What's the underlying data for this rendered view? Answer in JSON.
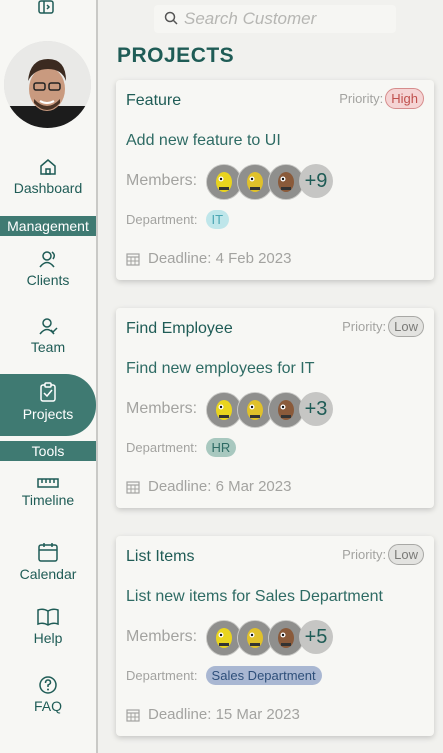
{
  "search": {
    "placeholder": "Search Customer"
  },
  "page": {
    "title": "PROJECTS"
  },
  "nav": {
    "dashboard": "Dashboard",
    "management": "Management",
    "clients": "Clients",
    "team": "Team",
    "projects": "Projects",
    "tools": "Tools",
    "timeline": "Timeline",
    "calendar": "Calendar",
    "help": "Help",
    "faq": "FAQ"
  },
  "labels": {
    "priority": "Priority:",
    "members": "Members:",
    "department": "Department:",
    "deadline": "Deadline:"
  },
  "projects": [
    {
      "title": "Feature",
      "priority": "High",
      "description": "Add new feature to UI",
      "members_more": "+9",
      "department": "IT",
      "department_color": "#bfe6ea",
      "department_text_color": "#4ba6b3",
      "deadline": "4 Feb 2023"
    },
    {
      "title": "Find Employee",
      "priority": "Low",
      "description": "Find new employees for IT",
      "members_more": "+3",
      "department": "HR",
      "department_color": "#a8c8bf",
      "department_text_color": "#2e6b64",
      "deadline": "6 Mar 2023"
    },
    {
      "title": "List Items",
      "priority": "Low",
      "description": "List new items for Sales Department",
      "members_more": "+5",
      "department": "Sales Department",
      "department_color": "#a9b7d2",
      "department_text_color": "#2e4f7a",
      "deadline": "15 Mar 2023"
    }
  ]
}
